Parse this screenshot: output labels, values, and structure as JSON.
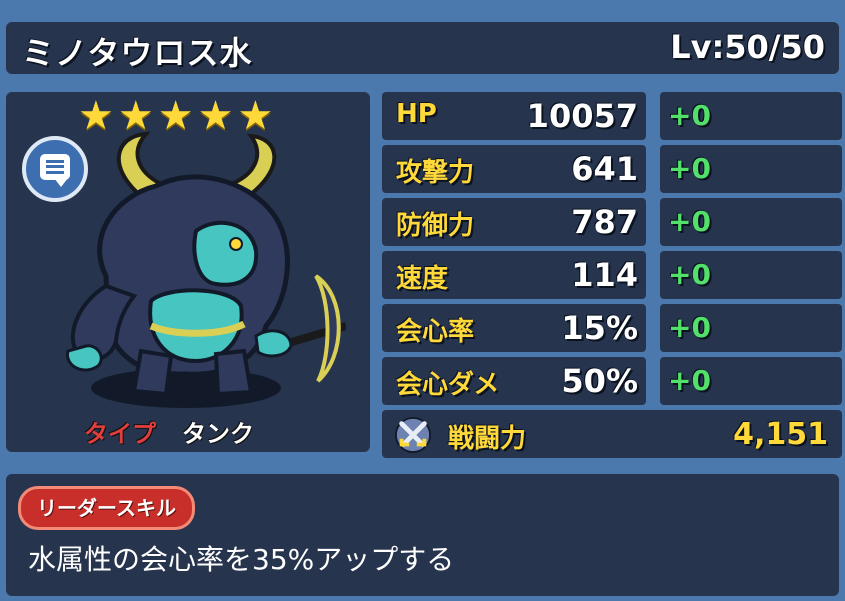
{
  "header": {
    "name": "ミノタウロス水",
    "level": "Lv:50/50"
  },
  "portrait": {
    "stars": [
      "★",
      "★",
      "★",
      "★",
      "★"
    ],
    "chat_icon": "speech-bubble-icon",
    "type_label": "タイプ",
    "type_value": "タンク"
  },
  "stats": [
    {
      "label": "HP",
      "value": "10057",
      "bonus": "+0"
    },
    {
      "label": "攻撃力",
      "value": "641",
      "bonus": "+0"
    },
    {
      "label": "防御力",
      "value": "787",
      "bonus": "+0"
    },
    {
      "label": "速度",
      "value": "114",
      "bonus": "+0"
    },
    {
      "label": "会心率",
      "value": "15%",
      "bonus": "+0"
    },
    {
      "label": "会心ダメ",
      "value": "50%",
      "bonus": "+0"
    }
  ],
  "power": {
    "icon": "crossed-swords-icon",
    "label": "戦闘力",
    "value": "4,151"
  },
  "skill": {
    "badge": "リーダースキル",
    "description": "水属性の会心率を35%アップする"
  },
  "colors": {
    "background": "#4b78ad",
    "panel": "#26344d",
    "accent_yellow": "#ffd83a",
    "bonus_green": "#53e06a",
    "type_red": "#e33e3e",
    "skill_badge": "#c92f2a"
  }
}
